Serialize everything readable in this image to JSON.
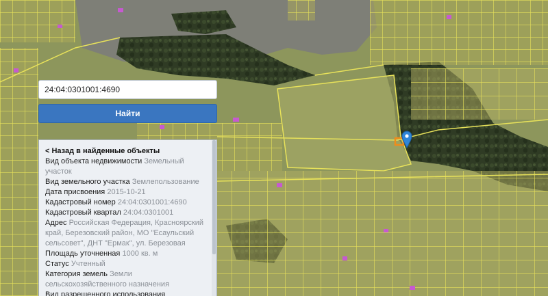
{
  "search": {
    "value": "24:04:0301001:4690",
    "button_label": "Найти"
  },
  "panel": {
    "back_label": "< Назад в найденные объекты",
    "rows": [
      {
        "label": "Вид объекта недвижимости",
        "value": "Земельный участок"
      },
      {
        "label": "Вид земельного участка",
        "value": "Землепользование"
      },
      {
        "label": "Дата присвоения",
        "value": "2015-10-21"
      },
      {
        "label": "Кадастровый номер",
        "value": "24:04:0301001:4690"
      },
      {
        "label": "Кадастровый квартал",
        "value": "24:04:0301001"
      },
      {
        "label": "Адрес",
        "value": "Российская Федерация, Красноярский край, Березовский район, МО \"Есаульский сельсовет\", ДНТ \"Ермак\", ул. Березовая"
      },
      {
        "label": "Площадь уточненная",
        "value": "1000 кв. м"
      },
      {
        "label": "Статус",
        "value": "Учтенный"
      },
      {
        "label": "Категория земель",
        "value": "Земли сельскохозяйственного назначения"
      },
      {
        "label": "Вид разрешенного использования",
        "value": ""
      }
    ]
  },
  "map": {
    "colors": {
      "parcel_outline": "#e8e25a",
      "parcel_fill": "#c9c45a",
      "forest": "#2e3a22",
      "field": "#8f9a5e",
      "building": "#c65ad0",
      "selected_parcel": "#f08c1a",
      "marker": "#2f86d8"
    }
  }
}
